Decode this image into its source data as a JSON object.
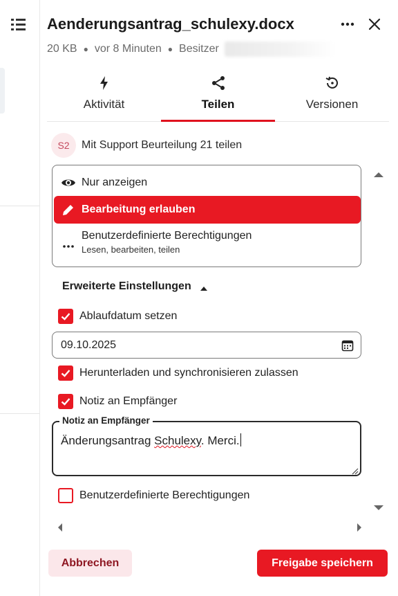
{
  "header": {
    "file_name": "Aenderungsantrag_schulexy.docx",
    "size": "20 KB",
    "modified": "vor 8 Minuten",
    "owner_label": "Besitzer",
    "more_icon": "more-horizontal-icon",
    "close_icon": "close-icon"
  },
  "sidebar": {
    "menu_icon": "list-menu-icon"
  },
  "tabs": [
    {
      "label": "Aktivität",
      "icon": "lightning-icon"
    },
    {
      "label": "Teilen",
      "icon": "share-icon",
      "active": true
    },
    {
      "label": "Versionen",
      "icon": "history-icon"
    }
  ],
  "share": {
    "avatar_initials": "S2",
    "label": "Mit Support Beurteilung 21 teilen"
  },
  "permissions": [
    {
      "label": "Nur anzeigen",
      "icon": "eye-icon"
    },
    {
      "label": "Bearbeitung erlauben",
      "icon": "pencil-icon",
      "selected": true
    },
    {
      "label": "Benutzerdefinierte Berechtigungen",
      "sublabel": "Lesen, bearbeiten, teilen",
      "icon": "dots-icon"
    }
  ],
  "advanced": {
    "title": "Erweiterte Einstellungen",
    "expiration": {
      "label": "Ablaufdatum setzen",
      "checked": true
    },
    "date_value": "09.10.2025",
    "download": {
      "label": "Herunterladen und synchronisieren zulassen",
      "checked": true
    },
    "note_toggle": {
      "label": "Notiz an Empfänger",
      "checked": true
    },
    "note_field_label": "Notiz an Empfänger",
    "note_text_before": "Änderungsantrag ",
    "note_text_misspelled": "Schulexy",
    "note_text_after": ". Merci.",
    "custom_permissions": {
      "label": "Benutzerdefinierte Berechtigungen",
      "checked": false
    }
  },
  "footer": {
    "cancel_label": "Abbrechen",
    "save_label": "Freigabe speichern"
  },
  "colors": {
    "accent": "#e81923",
    "accent_light": "#fbe7ea",
    "text": "#222222",
    "muted": "#6b6b6b"
  }
}
